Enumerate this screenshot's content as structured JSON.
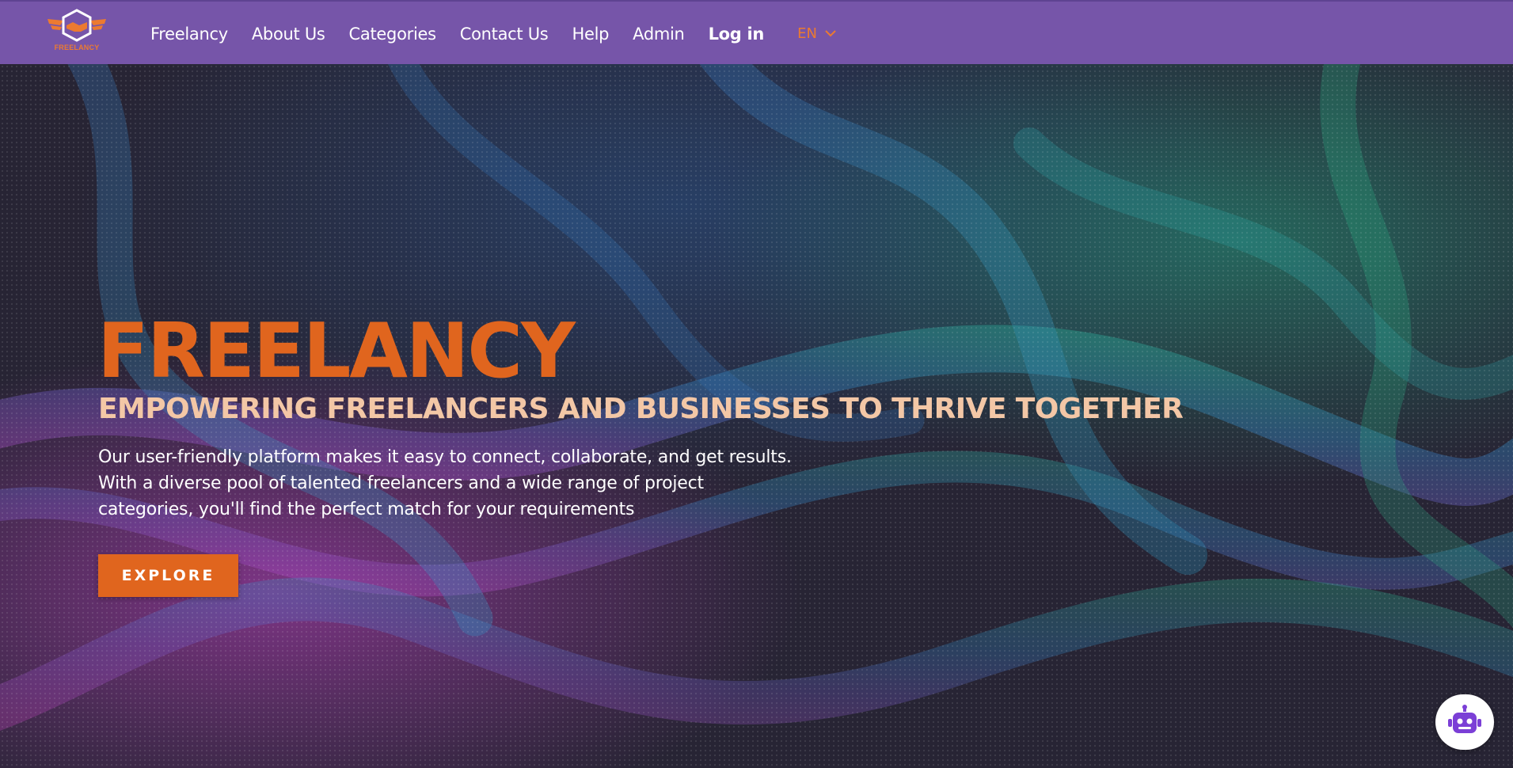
{
  "brand": {
    "logo_text": "FREELANCY",
    "logo_icon": "handshake-hexagon-icon",
    "colors": {
      "nav_bg": "#7655a9",
      "accent": "#e0651e",
      "subtitle": "#f3c7a6"
    }
  },
  "nav": {
    "links": [
      "Freelancy",
      "About Us",
      "Categories",
      "Contact Us",
      "Help",
      "Admin"
    ],
    "login": "Log in",
    "language": {
      "selected": "EN",
      "icon": "chevron-down-icon"
    }
  },
  "hero": {
    "title": "FREELANCY",
    "subtitle": "EMPOWERING FREELANCERS AND BUSINESSES TO THRIVE TOGETHER",
    "description": "Our user-friendly platform makes it easy to connect, collaborate, and get results. With a diverse pool of talented freelancers and a wide range of project categories, you'll find the perfect match for your requirements",
    "cta": "EXPLORE",
    "background": "particle-wave-image"
  },
  "chatbot": {
    "icon": "robot-icon"
  }
}
